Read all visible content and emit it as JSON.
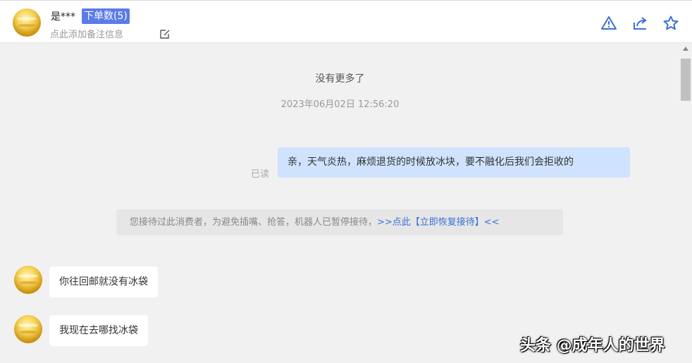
{
  "header": {
    "name": "是***",
    "order_badge": "下单数(5)",
    "note_placeholder": "点此添加备注信息",
    "icons": [
      "warning-icon",
      "share-icon",
      "star-icon"
    ],
    "badge_color": "#5b7be8"
  },
  "chat": {
    "no_more": "没有更多了",
    "timestamp": "2023年06月02日 12:56:20",
    "read_status": "已读",
    "outgoing_message": "亲，天气炎热，麻烦退货的时候放冰块，要不融化后我们会拒收的",
    "system_notice": "您接待过此消费者，为避免插嘴、抢答，机器人已暂停接待，",
    "system_link": ">>点此【立即恢复接待】<<",
    "incoming_messages": [
      "你往回邮就没有冰袋",
      "我现在去哪找冰袋"
    ]
  },
  "watermark": "头条 @成年人的世界",
  "colors": {
    "outgoing_bubble": "#cfe3ff",
    "link": "#3a6fd8",
    "icon": "#3a6fd8"
  }
}
